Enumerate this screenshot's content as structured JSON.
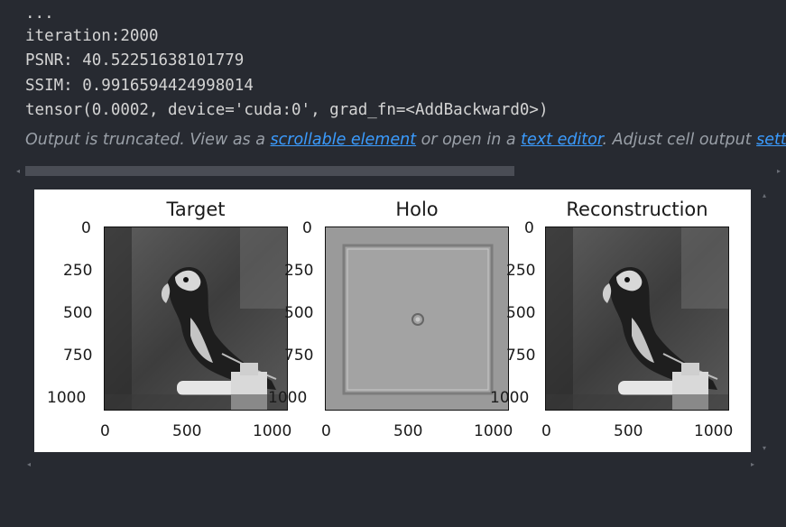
{
  "output": {
    "lines": [
      "...",
      "iteration:2000",
      "PSNR: 40.52251638101779",
      "SSIM: 0.9916594424998014",
      "tensor(0.0002, device='cuda:0', grad_fn=<AddBackward0>)"
    ],
    "truncation": {
      "prefix": "Output is truncated. View as a ",
      "link1": "scrollable element",
      "middle": " or open in a ",
      "link2": "text editor",
      "suffix": ". Adjust cell output ",
      "link3": "settings"
    }
  },
  "figure": {
    "panels": [
      {
        "title": "Target"
      },
      {
        "title": "Holo"
      },
      {
        "title": "Reconstruction"
      }
    ],
    "y_ticks": [
      "0",
      "250",
      "500",
      "750",
      "1000"
    ],
    "x_ticks": [
      "0",
      "500",
      "1000"
    ]
  },
  "colors": {
    "background": "#272a31",
    "text": "#d4d4d4",
    "link": "#3b9cff",
    "muted": "#9aa0a8"
  }
}
